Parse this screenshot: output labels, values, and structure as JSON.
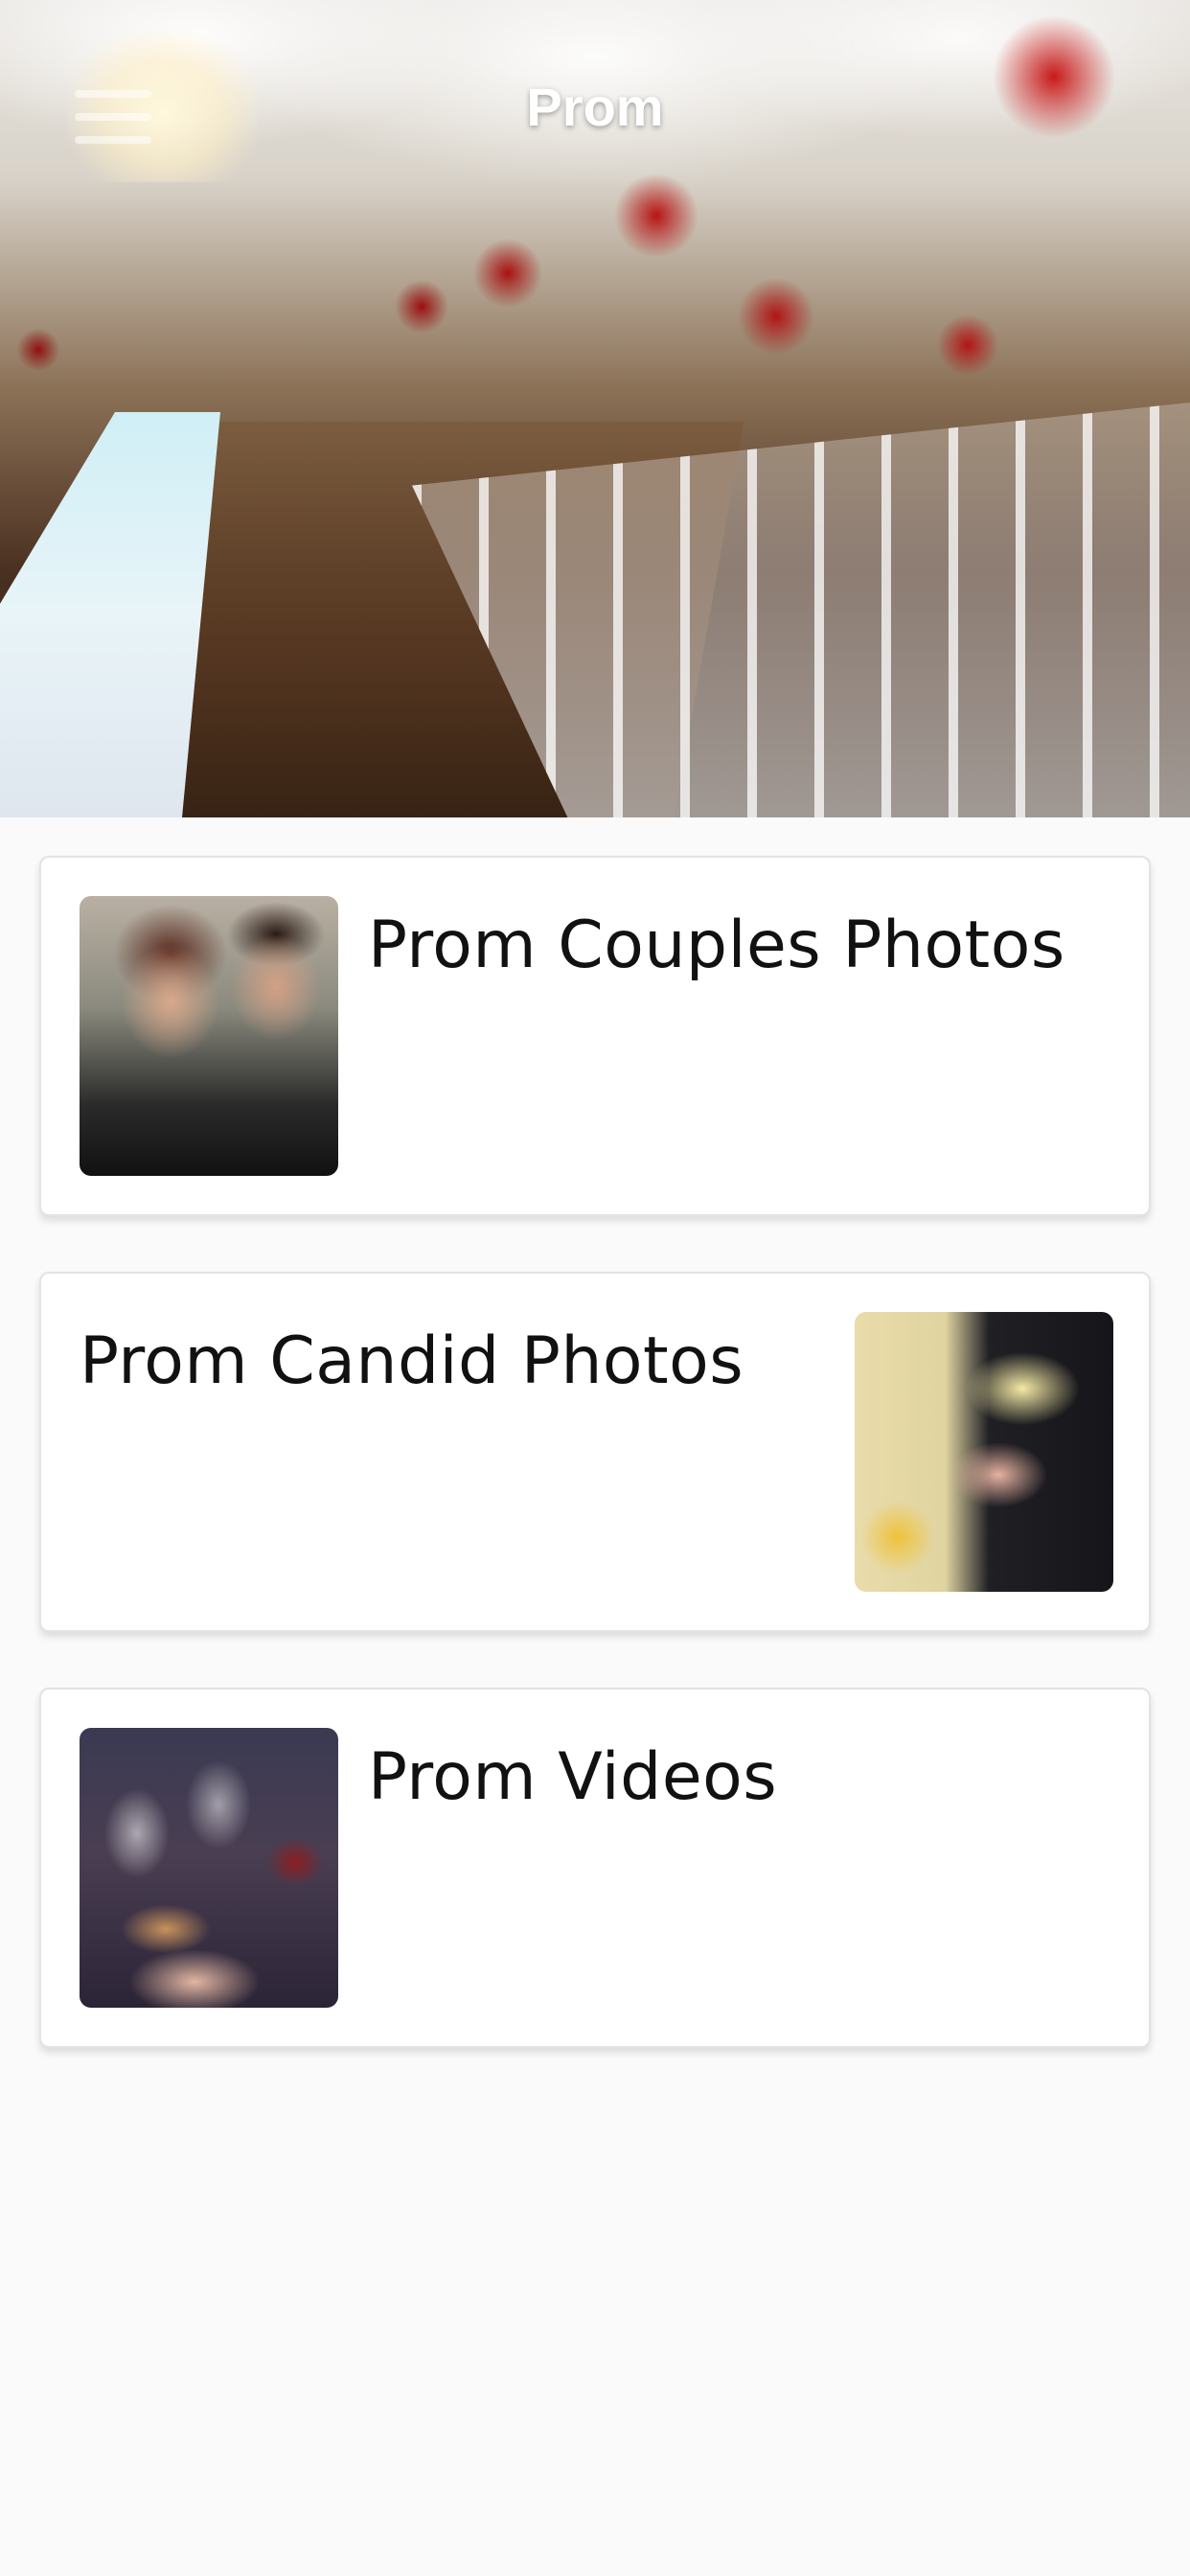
{
  "header": {
    "title": "Prom",
    "menu_icon": "hamburger-menu-icon",
    "background_image": "banquet-hall-image"
  },
  "cards": [
    {
      "title": "Prom Couples Photos",
      "thumbnail": "couple-photo-thumbnail",
      "image_side": "left"
    },
    {
      "title": "Prom Candid Photos",
      "thumbnail": "candid-hands-thumbnail",
      "image_side": "right"
    },
    {
      "title": "Prom Videos",
      "thumbnail": "toast-glasses-thumbnail",
      "image_side": "left"
    }
  ],
  "colors": {
    "page_background": "#fafafa",
    "card_background": "#ffffff",
    "card_border": "#e3e3e3",
    "title_text": "#111111",
    "header_text": "#ffffff"
  }
}
